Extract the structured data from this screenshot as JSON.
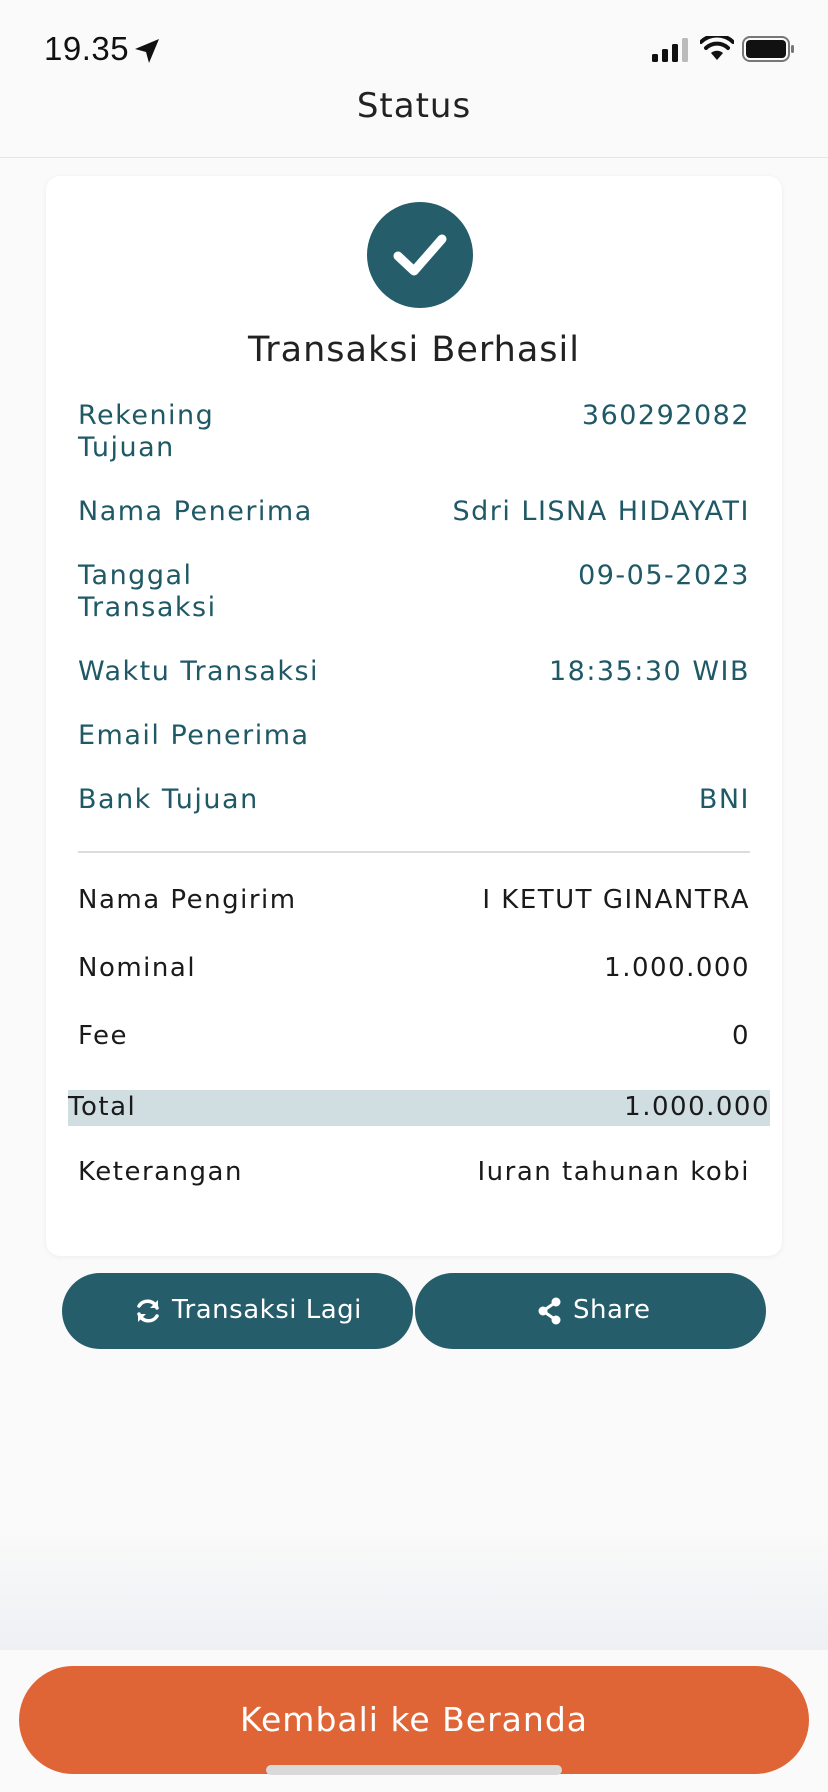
{
  "status_bar": {
    "time": "19.35"
  },
  "header": {
    "title": "Status"
  },
  "result": {
    "title": "Transaksi Berhasil"
  },
  "recipient_details": [
    {
      "label": "Rekening Tujuan",
      "value": "360292082"
    },
    {
      "label": "Nama Penerima",
      "value": "Sdri LISNA HIDAYATI"
    },
    {
      "label": "Tanggal Transaksi",
      "value": "09-05-2023"
    },
    {
      "label": "Waktu Transaksi",
      "value": "18:35:30 WIB"
    },
    {
      "label": "Email Penerima",
      "value": ""
    },
    {
      "label": "Bank Tujuan",
      "value": "BNI"
    }
  ],
  "summary": [
    {
      "label": "Nama Pengirim",
      "value": "I KETUT GINANTRA"
    },
    {
      "label": "Nominal",
      "value": "1.000.000"
    },
    {
      "label": "Fee",
      "value": "0"
    }
  ],
  "total": {
    "label": "Total",
    "value": "1.000.000"
  },
  "note": {
    "label": "Keterangan",
    "value": "Iuran tahunan kobi"
  },
  "buttons": {
    "again": {
      "label": "Transaksi Lagi",
      "icon": "refresh-icon"
    },
    "share": {
      "label": "Share",
      "icon": "share-icon"
    },
    "home": {
      "label": "Kembali ke Beranda"
    }
  },
  "colors": {
    "primary": "#255d6b",
    "accent": "#e06536",
    "total_bg": "#d0dee2"
  }
}
